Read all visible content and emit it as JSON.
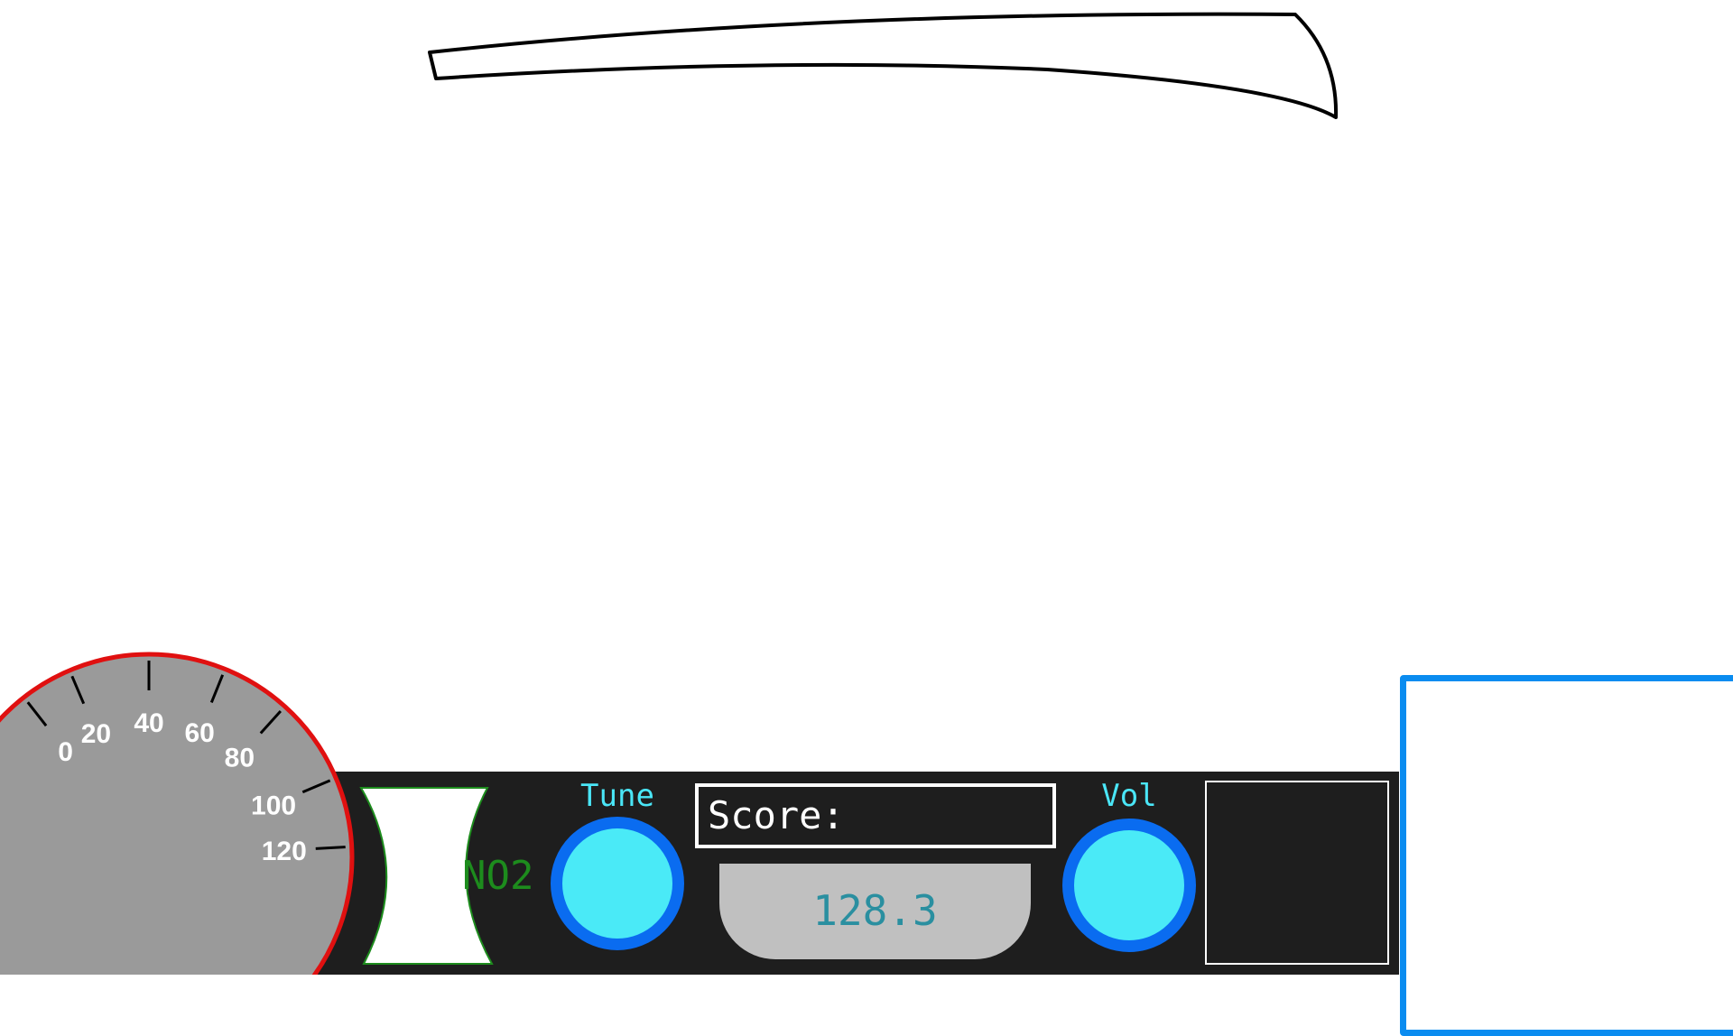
{
  "speedometer": {
    "ticks": [
      "0",
      "20",
      "40",
      "60",
      "80",
      "100",
      "120"
    ],
    "rim_color": "#e01010",
    "face_color": "#9a9a9a"
  },
  "nitro": {
    "label": "NO2",
    "color": "#1d8c1d"
  },
  "radio": {
    "tune_label": "Tune",
    "vol_label": "Vol",
    "score_label": "Score:",
    "frequency": "128.3",
    "knob_color": "#4aeaf7",
    "knob_ring_color": "#0a6cf0"
  },
  "colors": {
    "dashboard": "#1e1e1e",
    "side_panel_border": "#0a8cf0"
  }
}
